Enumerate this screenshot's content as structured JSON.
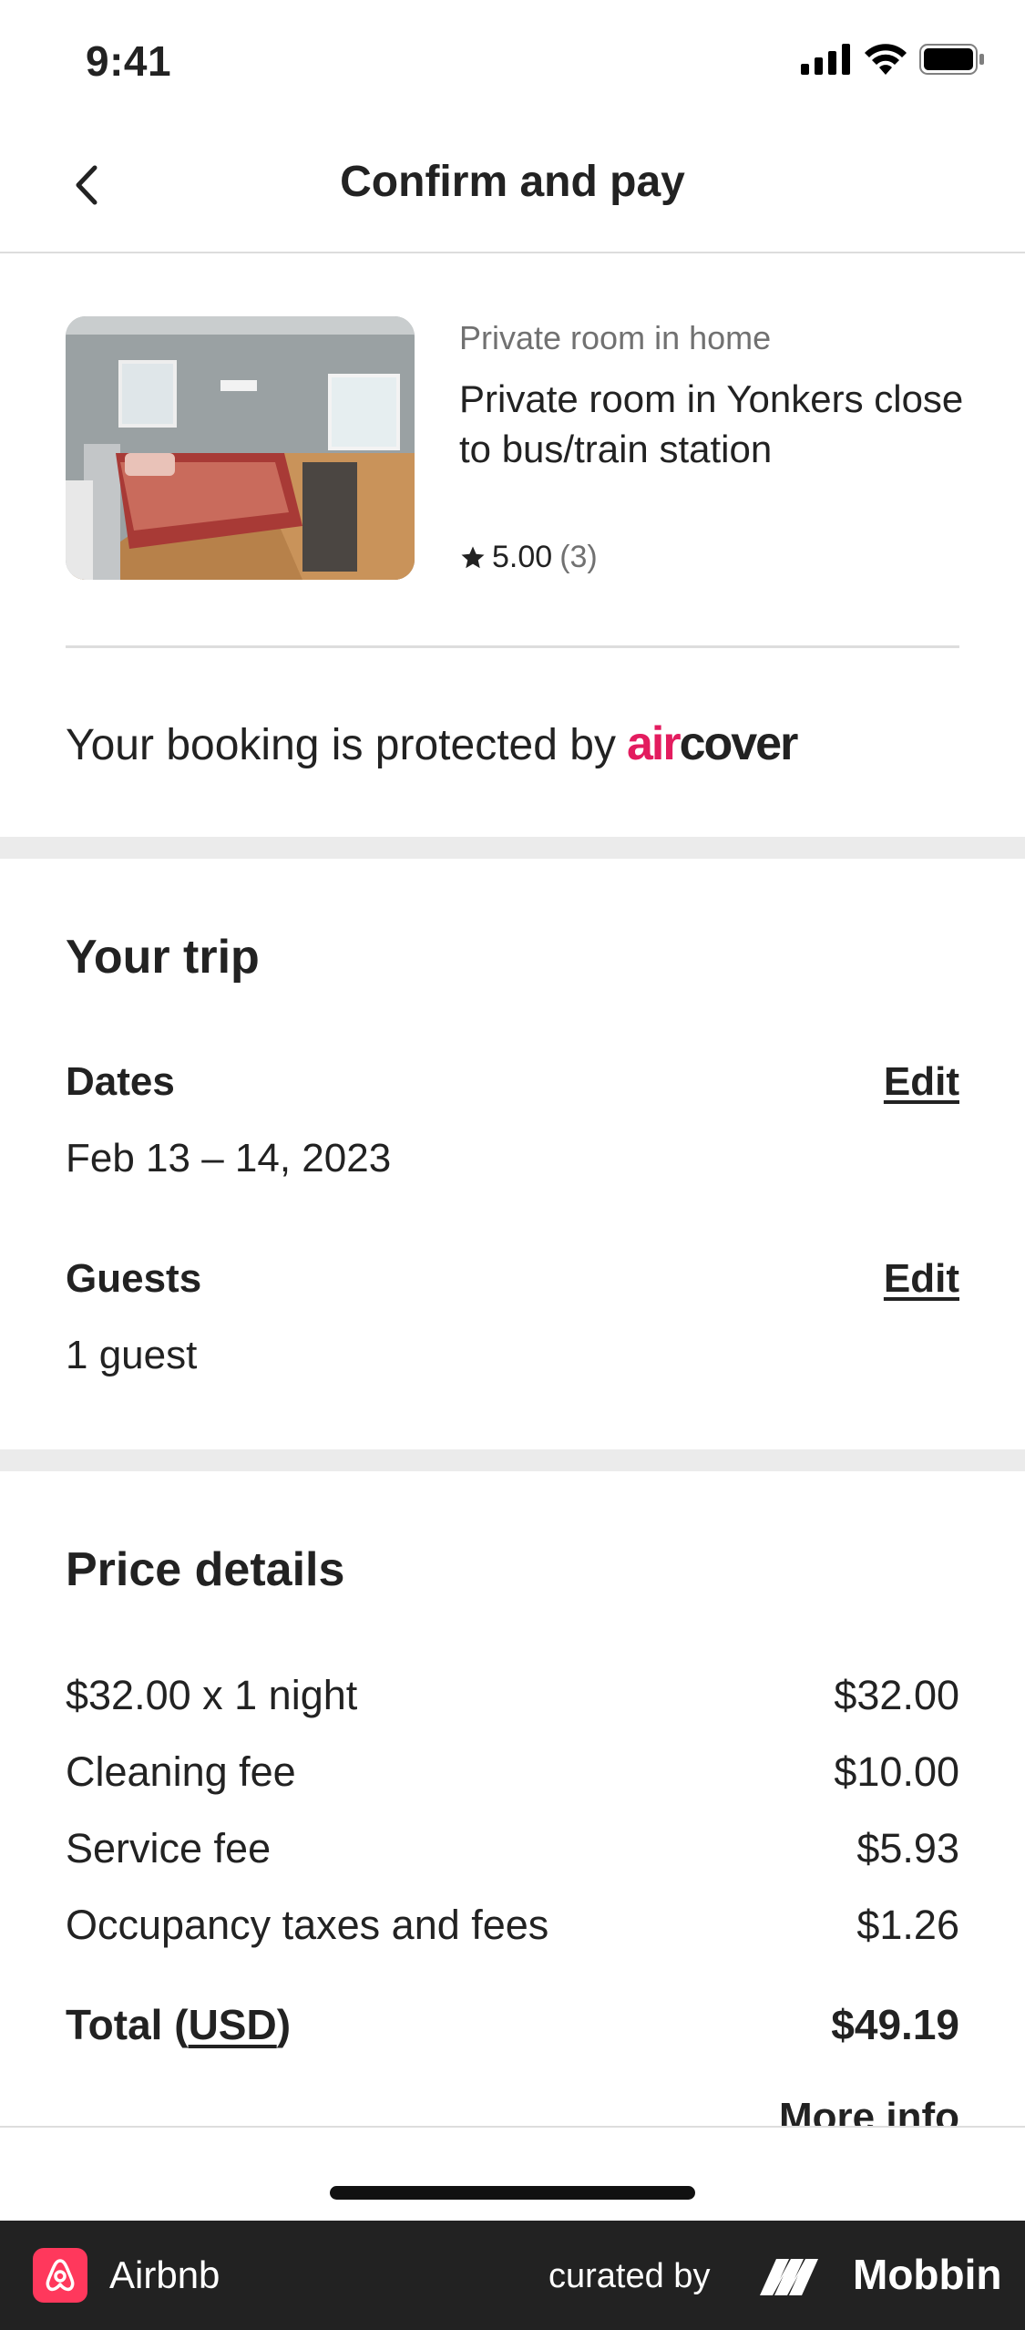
{
  "status_bar": {
    "time": "9:41"
  },
  "header": {
    "title": "Confirm and pay"
  },
  "listing": {
    "type": "Private room in home",
    "title": "Private room in Yonkers close to bus/train station",
    "rating": "5.00",
    "reviews": "(3)"
  },
  "protection": {
    "text": "Your booking is protected by",
    "brand_air": "air",
    "brand_cover": "cover"
  },
  "trip": {
    "title": "Your trip",
    "dates_label": "Dates",
    "dates_value": "Feb 13 – 14, 2023",
    "guests_label": "Guests",
    "guests_value": "1 guest",
    "edit_label": "Edit"
  },
  "price": {
    "title": "Price details",
    "items": [
      {
        "label": "$32.00 x 1 night",
        "value": "$32.00"
      },
      {
        "label": "Cleaning fee",
        "value": "$10.00"
      },
      {
        "label": "Service fee",
        "value": "$5.93"
      },
      {
        "label": "Occupancy taxes and fees",
        "value": "$1.26"
      }
    ],
    "total_prefix": "Total (",
    "total_currency": "USD",
    "total_suffix": ")",
    "total_value": "$49.19",
    "more_info": "More info"
  },
  "footer": {
    "app": "Airbnb",
    "curated_by": "curated by",
    "brand": "Mobbin"
  },
  "colors": {
    "brand": "#ff385c",
    "aircover_red": "#e31c5f",
    "footer_bg": "#222222"
  }
}
